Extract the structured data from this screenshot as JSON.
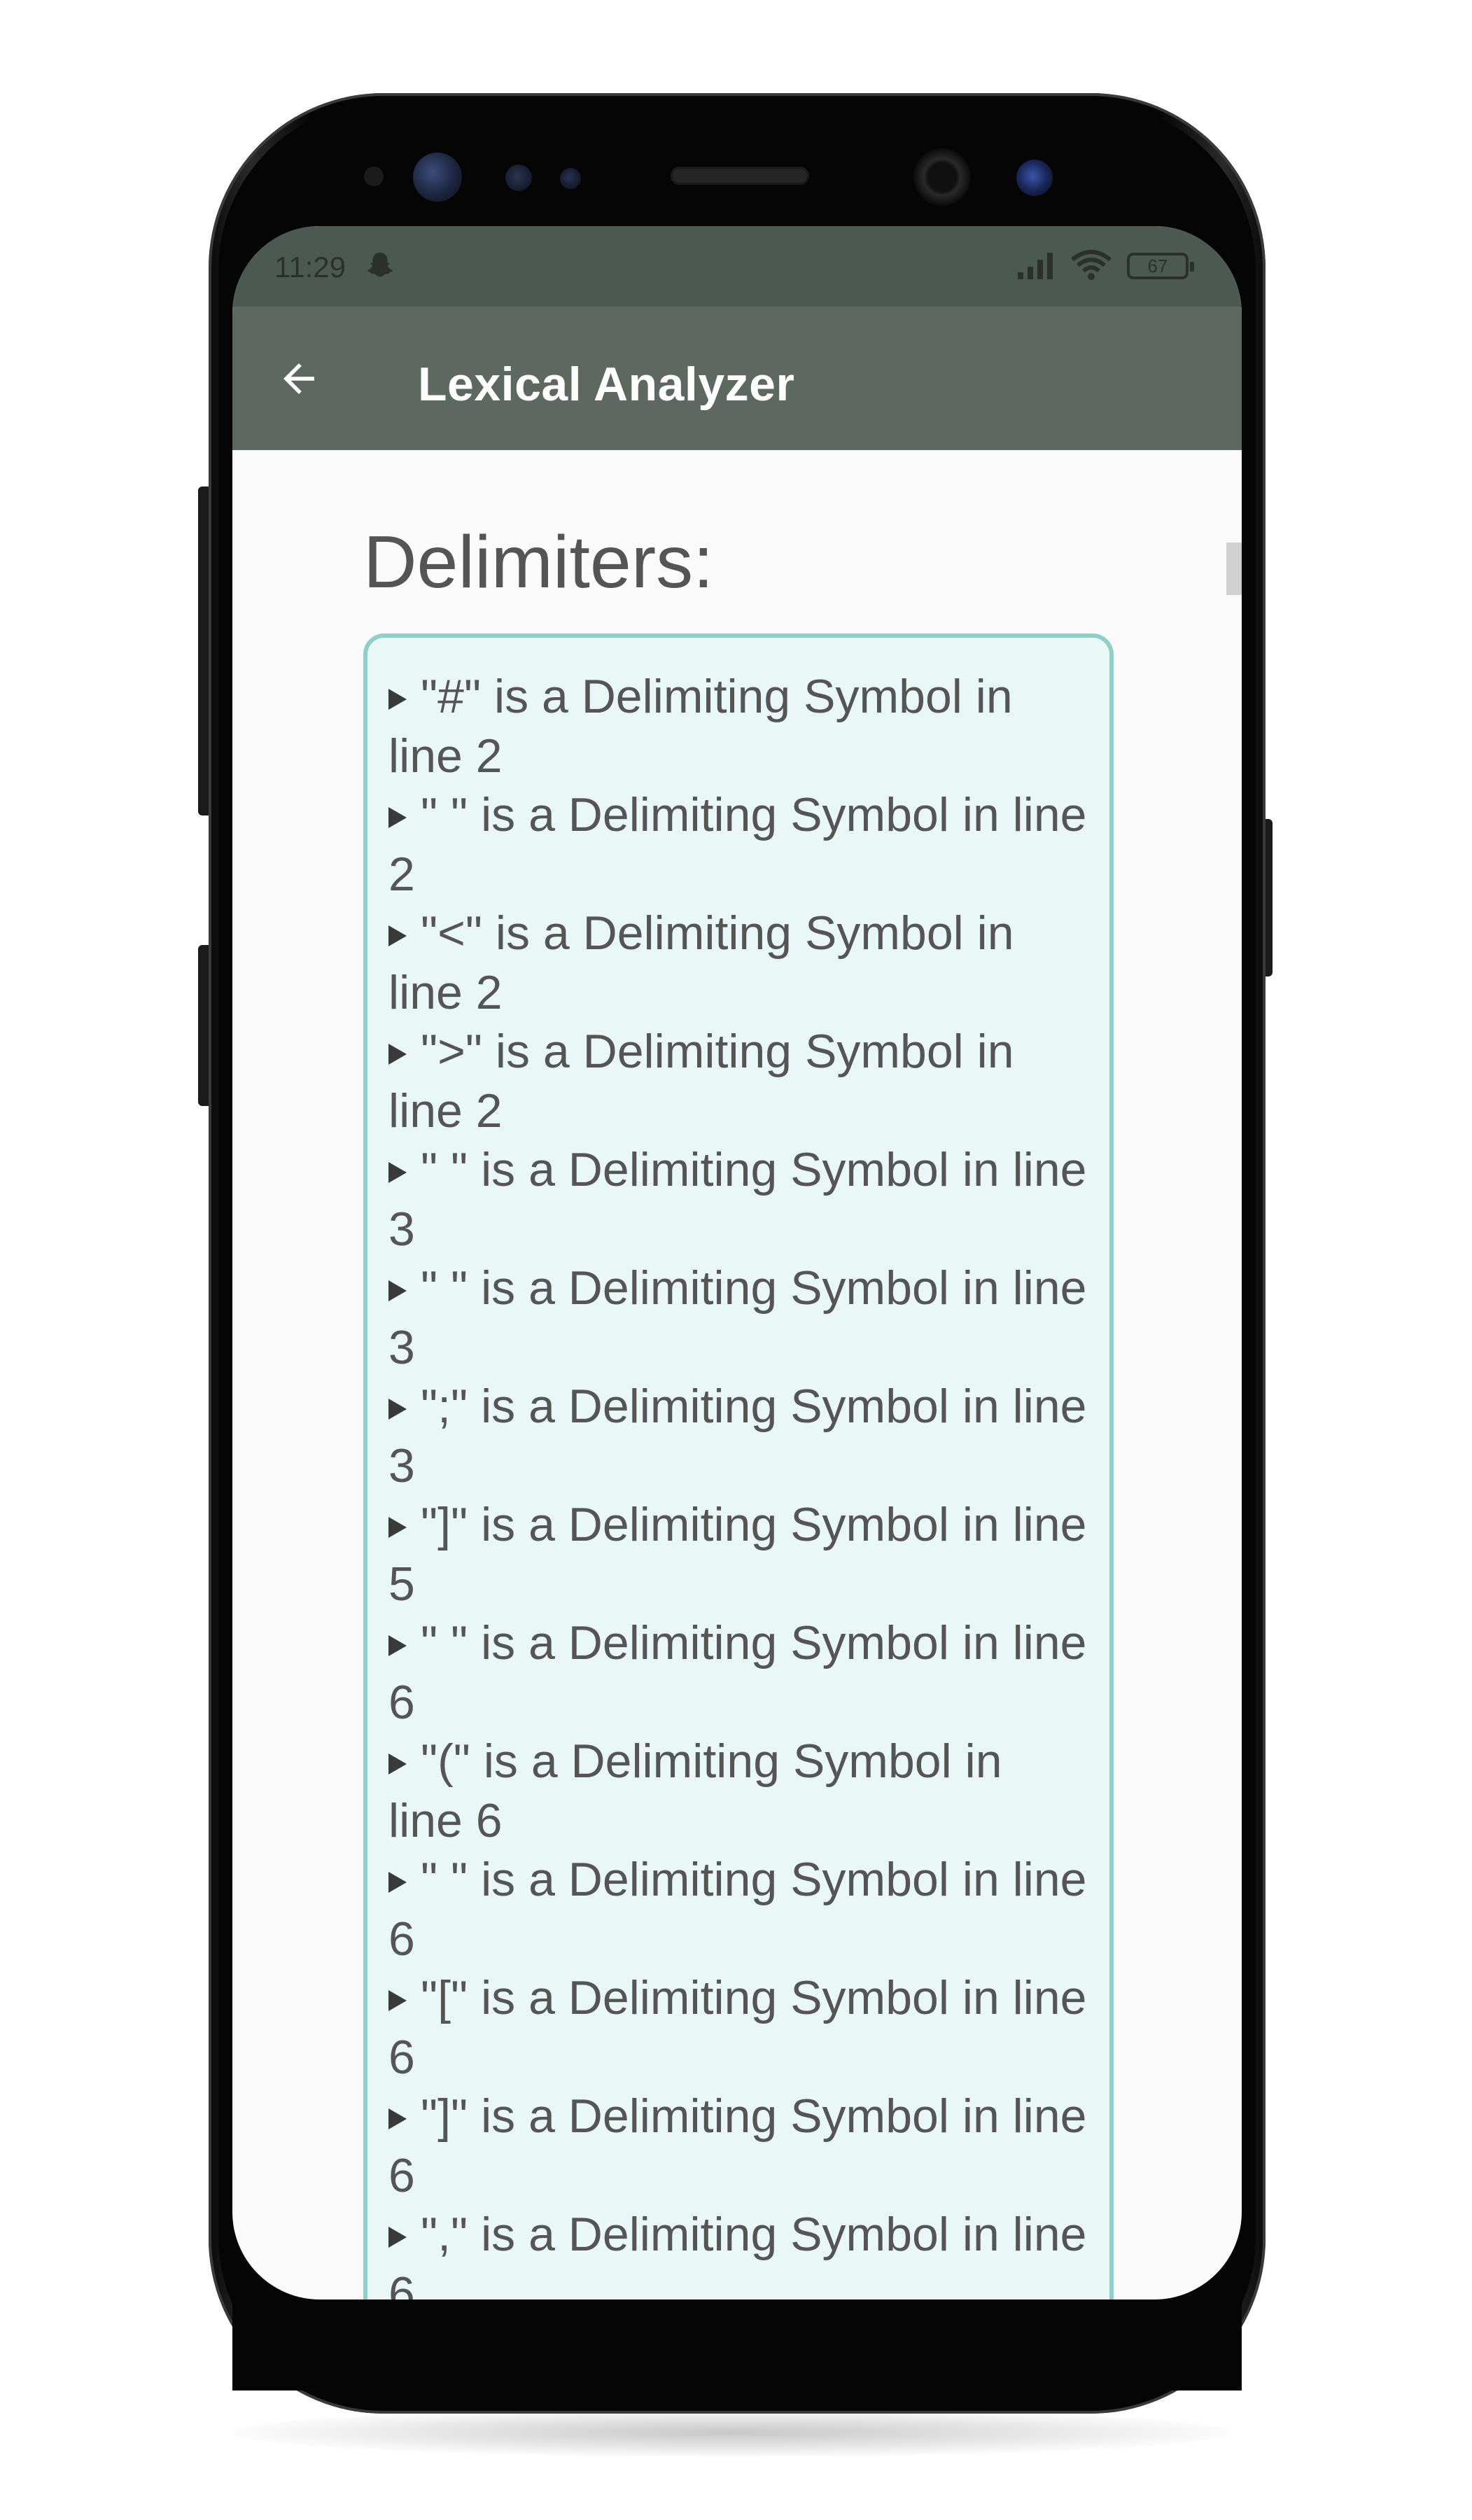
{
  "status_bar": {
    "time": "11:29",
    "battery": "67",
    "icons": [
      "snapchat-ghost-icon",
      "cellular-signal-icon",
      "wifi-icon",
      "battery-icon"
    ]
  },
  "app_bar": {
    "title": "Lexical Analyzer",
    "back_icon": "arrow-left-icon",
    "color": "#5d6861"
  },
  "section": {
    "heading": "Delimiters:"
  },
  "delimiters": [
    {
      "text": "\"#\" is a Delimiting Symbol in line 2"
    },
    {
      "text": "\" \" is a Delimiting Symbol in line 2"
    },
    {
      "text": "\"<\" is a Delimiting Symbol in line 2"
    },
    {
      "text": "\">\" is a Delimiting Symbol in line 2"
    },
    {
      "text": "\" \" is a Delimiting Symbol in line 3"
    },
    {
      "text": "\" \" is a Delimiting Symbol in line 3"
    },
    {
      "text": "\";\" is a Delimiting Symbol in line 3"
    },
    {
      "text": "\"]\" is a Delimiting Symbol in line 5"
    },
    {
      "text": "\" \" is a Delimiting Symbol in line 6"
    },
    {
      "text": "\"(\" is a Delimiting Symbol in line 6"
    },
    {
      "text": "\" \" is a Delimiting Symbol in line 6"
    },
    {
      "text": "\"[\" is a Delimiting Symbol in line 6"
    },
    {
      "text": "\"]\" is a Delimiting Symbol in line 6"
    },
    {
      "text": "\",\" is a Delimiting Symbol in line 6"
    }
  ],
  "colors": {
    "box_border": "#8fcfc7",
    "box_background": "#e9f7f6",
    "text": "#555555"
  }
}
